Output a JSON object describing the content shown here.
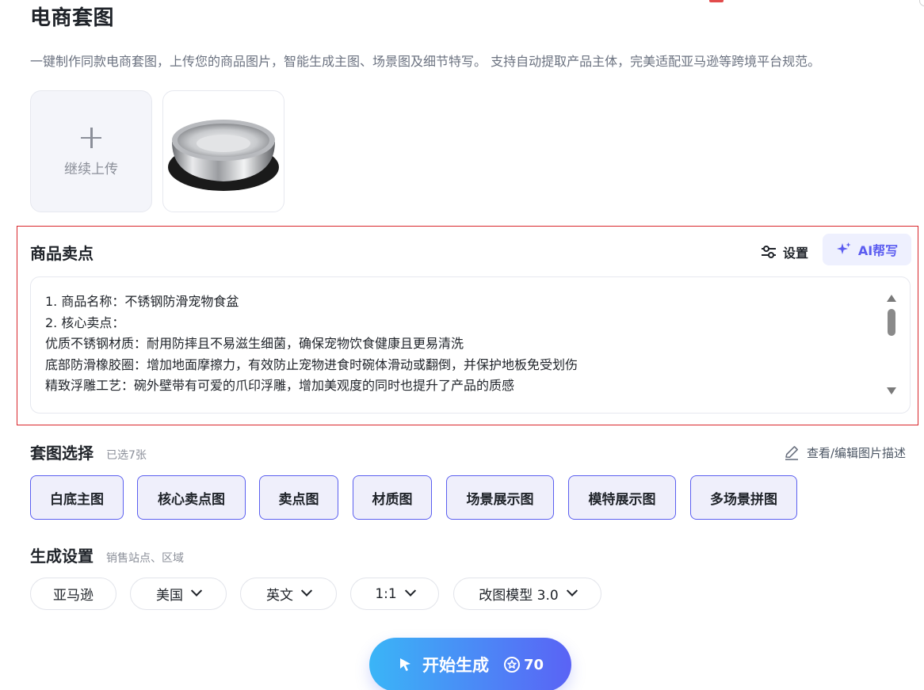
{
  "header": {
    "title": "电商套图",
    "description": "一键制作同款电商套图，上传您的商品图片，智能生成主图、场景图及细节特写。 支持自动提取产品主体，完美适配亚马逊等跨境平台规范。"
  },
  "upload": {
    "continue_label": "继续上传"
  },
  "selling_points": {
    "title": "商品卖点",
    "settings_label": "设置",
    "ai_label": "AI帮写",
    "lines": [
      "1. 商品名称：不锈钢防滑宠物食盆",
      "2. 核心卖点：",
      "优质不锈钢材质：耐用防摔且不易滋生细菌，确保宠物饮食健康且更易清洗",
      "底部防滑橡胶圈：增加地面摩擦力，有效防止宠物进食时碗体滑动或翻倒，并保护地板免受划伤",
      "精致浮雕工艺：碗外壁带有可爱的爪印浮雕，增加美观度的同时也提升了产品的质感"
    ]
  },
  "set_selection": {
    "title": "套图选择",
    "selected_count": "已选7张",
    "edit_label": "查看/编辑图片描述",
    "chips": [
      "白底主图",
      "核心卖点图",
      "卖点图",
      "材质图",
      "场景展示图",
      "模特展示图",
      "多场景拼图"
    ]
  },
  "generation": {
    "title": "生成设置",
    "hint": "销售站点、区域",
    "platform": "亚马逊",
    "region": "美国",
    "language": "英文",
    "ratio": "1:1",
    "model": "改图模型 3.0"
  },
  "start": {
    "label": "开始生成",
    "cost": "70"
  },
  "colors": {
    "accent": "#5b5ff0",
    "highlight_border": "#d9252b",
    "button_gradient_start": "#3ab5f7",
    "button_gradient_end": "#5a63f5"
  }
}
